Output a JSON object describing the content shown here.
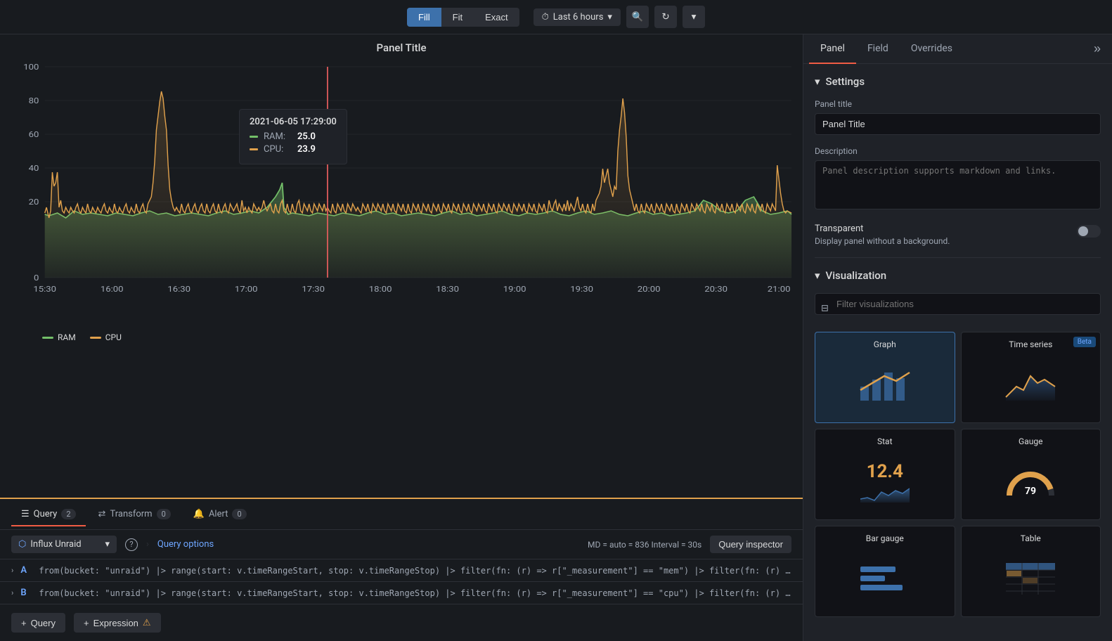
{
  "toolbar": {
    "fill_label": "Fill",
    "fit_label": "Fit",
    "exact_label": "Exact",
    "time_range": "Last 6 hours",
    "active_btn": "fill"
  },
  "chart": {
    "title": "Panel Title",
    "y_labels": [
      "100",
      "80",
      "60",
      "40",
      "20",
      "0"
    ],
    "x_labels": [
      "15:30",
      "16:00",
      "16:30",
      "17:00",
      "17:30",
      "18:00",
      "18:30",
      "19:00",
      "19:30",
      "20:00",
      "20:30",
      "21:00"
    ],
    "tooltip": {
      "date": "2021-06-05 17:29:00",
      "ram_label": "RAM:",
      "ram_value": "25.0",
      "cpu_label": "CPU:",
      "cpu_value": "23.9"
    },
    "legend": {
      "ram_label": "RAM",
      "cpu_label": "CPU"
    }
  },
  "query_section": {
    "tabs": [
      {
        "label": "Query",
        "badge": "2",
        "active": true
      },
      {
        "label": "Transform",
        "badge": "0",
        "active": false
      },
      {
        "label": "Alert",
        "badge": "0",
        "active": false
      }
    ],
    "datasource": "Influx Unraid",
    "query_options_label": "Query options",
    "meta": "MD = auto = 836     Interval = 30s",
    "inspector_btn": "Query inspector",
    "queries": [
      {
        "key": "A",
        "text": "from(bucket: \"unraid\") |> range(start: v.timeRangeStart, stop: v.timeRangeStop) |> filter(fn: (r) => r[\"_measurement\"] == \"mem\") |> filter(fn: (r) => r[\"_fie..."
      },
      {
        "key": "B",
        "text": "from(bucket: \"unraid\") |> range(start: v.timeRangeStart, stop: v.timeRangeStop) |> filter(fn: (r) => r[\"_measurement\"] == \"cpu\") |> filter(fn: (r) => r[\"_field..."
      }
    ],
    "add_query": "+ Query",
    "add_expression": "+ Expression"
  },
  "right_panel": {
    "tabs": [
      "Panel",
      "Field",
      "Overrides"
    ],
    "active_tab": "Panel",
    "collapse_icon": "»",
    "settings": {
      "section_label": "Settings",
      "panel_title_label": "Panel title",
      "panel_title_value": "Panel Title",
      "description_label": "Description",
      "description_placeholder": "Panel description supports markdown and links.",
      "transparent_label": "Transparent",
      "transparent_desc": "Display panel without a background."
    },
    "visualization": {
      "section_label": "Visualization",
      "filter_placeholder": "Filter visualizations",
      "cards": [
        {
          "id": "graph",
          "label": "Graph",
          "selected": true
        },
        {
          "id": "time-series",
          "label": "Time series",
          "badge": "Beta"
        },
        {
          "id": "stat",
          "label": "Stat",
          "value": "12.4"
        },
        {
          "id": "gauge",
          "label": "Gauge",
          "value": "79"
        },
        {
          "id": "bar-gauge",
          "label": "Bar gauge"
        },
        {
          "id": "table",
          "label": "Table"
        }
      ]
    }
  }
}
